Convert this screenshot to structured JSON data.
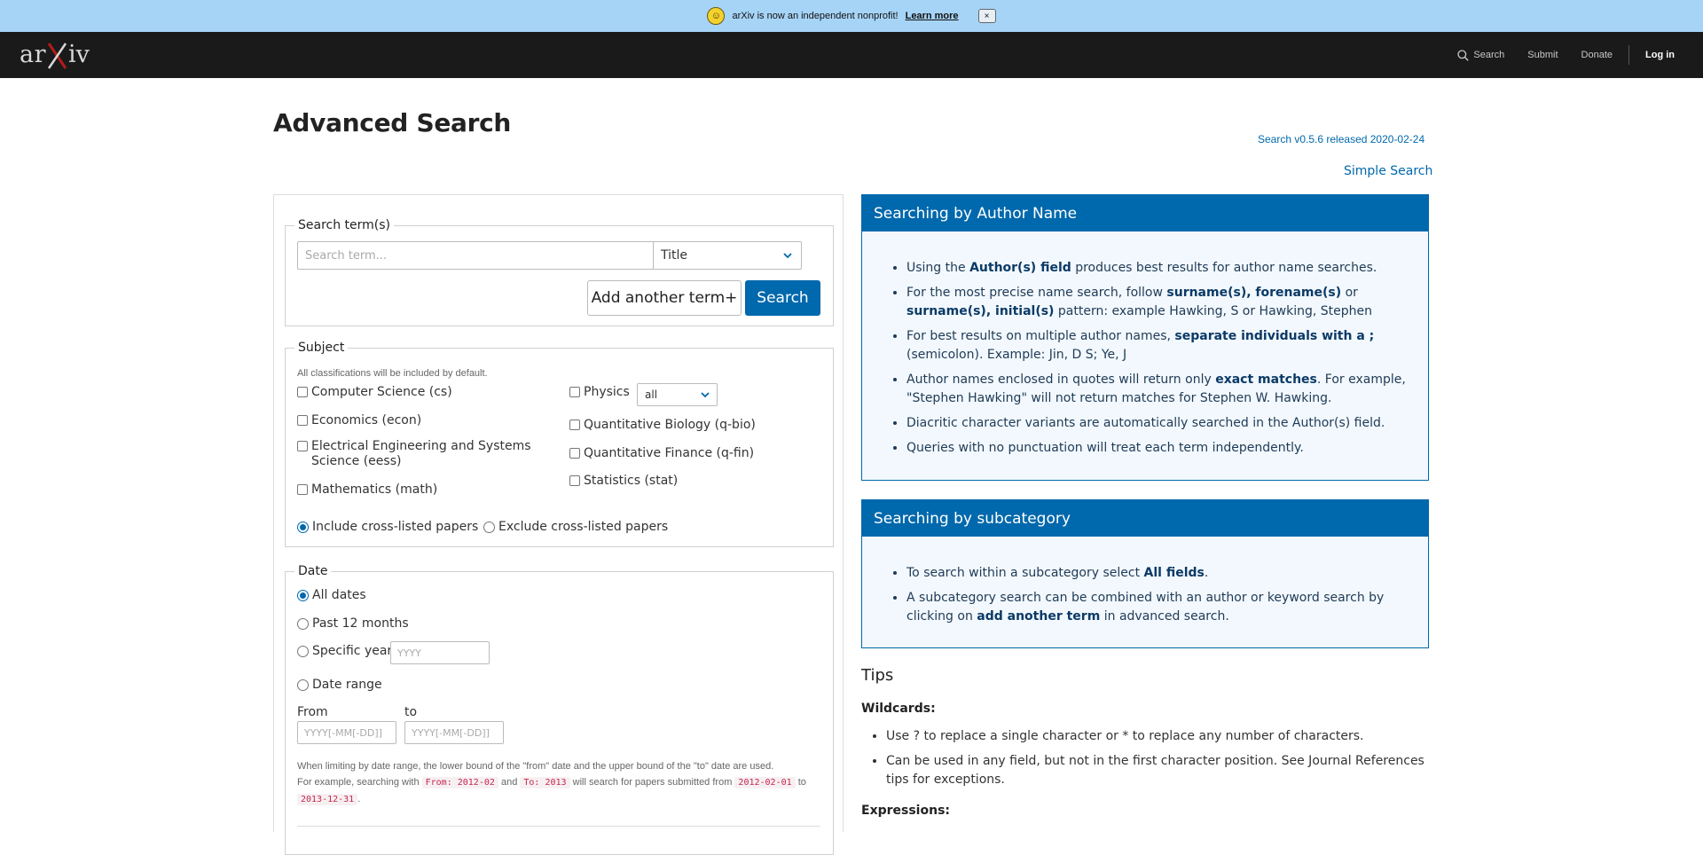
{
  "banner": {
    "message": "arXiv is now an independent nonprofit!",
    "learn_more": "Learn more",
    "close": "×"
  },
  "header": {
    "logo_text": "arXiv",
    "nav": {
      "search": "Search",
      "submit": "Submit",
      "donate": "Donate",
      "login": "Log in"
    }
  },
  "page": {
    "title": "Advanced Search",
    "version": "Search v0.5.6 released 2020-02-24",
    "simple_search": "Simple Search"
  },
  "terms": {
    "legend": "Search term(s)",
    "input_value": "",
    "input_placeholder": "Search term...",
    "field_selected": "Title",
    "add_label": "Add another term+",
    "search_label": "Search"
  },
  "subject": {
    "legend": "Subject",
    "hint": "All classifications will be included by default.",
    "left": [
      {
        "label": "Computer Science (cs)",
        "checked": false
      },
      {
        "label": "Economics (econ)",
        "checked": false
      },
      {
        "label": "Electrical Engineering and Systems Science (eess)",
        "checked": false
      },
      {
        "label": "Mathematics (math)",
        "checked": false
      }
    ],
    "right": [
      {
        "label": "Physics",
        "checked": false
      },
      {
        "label": "Quantitative Biology (q-bio)",
        "checked": false
      },
      {
        "label": "Quantitative Finance (q-fin)",
        "checked": false
      },
      {
        "label": "Statistics (stat)",
        "checked": false
      }
    ],
    "physics_select": "all",
    "cross_include": "Include cross-listed papers",
    "cross_exclude": "Exclude cross-listed papers",
    "cross_selected": "include"
  },
  "date": {
    "legend": "Date",
    "all_dates": "All dates",
    "past_12": "Past 12 months",
    "specific_year": "Specific year",
    "year_placeholder": "YYYY",
    "date_range": "Date range",
    "from_label": "From",
    "to_label": "to",
    "from_placeholder": "YYYY[-MM[-DD]]",
    "to_placeholder": "YYYY[-MM[-DD]]",
    "selected": "all_dates",
    "note_1": "When limiting by date range, the lower bound of the \"from\" date and the upper bound of the \"to\" date are used.",
    "note_2a": "For example, searching with",
    "code_from": "From: 2012-02",
    "note_and": "and",
    "code_to": "To: 2013",
    "note_2b": "will search for papers submitted from",
    "code_start": "2012-02-01",
    "note_to": "to",
    "code_end": "2013-12-31",
    "note_end": "."
  },
  "author_card": {
    "title": "Searching by Author Name",
    "items": [
      {
        "parts": [
          "Using the ",
          "Author(s) field",
          " produces best results for author name searches."
        ]
      },
      {
        "parts": [
          "For the most precise name search, follow ",
          "surname(s), forename(s)",
          " or ",
          "surname(s), initial(s)",
          " pattern: example Hawking, S or Hawking, Stephen"
        ]
      },
      {
        "parts": [
          "For best results on multiple author names, ",
          "separate individuals with a ;",
          " (semicolon). Example: Jin, D S; Ye, J"
        ]
      },
      {
        "parts": [
          "Author names enclosed in quotes will return only ",
          "exact matches",
          ". For example, \"Stephen Hawking\" will not return matches for Stephen W. Hawking."
        ]
      },
      {
        "parts": [
          "Diacritic character variants are automatically searched in the Author(s) field."
        ]
      },
      {
        "parts": [
          "Queries with no punctuation will treat each term independently."
        ]
      }
    ]
  },
  "subcategory_card": {
    "title": "Searching by subcategory",
    "items": [
      {
        "parts": [
          "To search within a subcategory select ",
          "All fields",
          "."
        ]
      },
      {
        "parts": [
          "A subcategory search can be combined with an author or keyword search by clicking on ",
          "add another term",
          " in advanced search."
        ]
      }
    ]
  },
  "tips": {
    "title": "Tips",
    "wildcards": "Wildcards:",
    "items": [
      "Use ? to replace a single character or * to replace any number of characters.",
      "Can be used in any field, but not in the first character position. See Journal References tips for exceptions."
    ],
    "expressions": "Expressions:"
  },
  "colors": {
    "accent": "#0068ac",
    "header_bg": "#1a1a1a",
    "banner_bg": "#a6d4f7",
    "logo_red": "#b31b1b"
  }
}
